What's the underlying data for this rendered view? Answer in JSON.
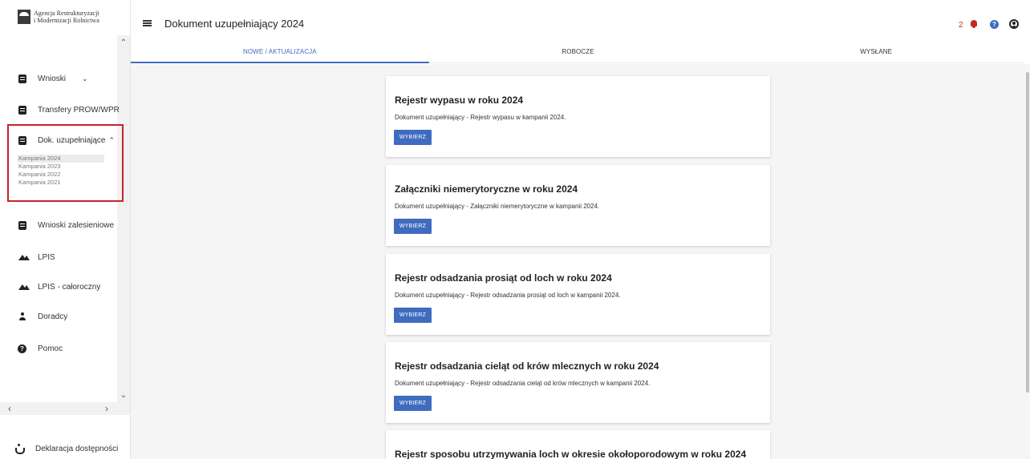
{
  "sidebar": {
    "logo": {
      "line1": "Agencja Restrukturyzacji",
      "line2": "i Modernizacji Rolnictwa"
    },
    "items": [
      {
        "label": "Wnioski",
        "icon": "document-icon"
      },
      {
        "label": "Transfery PROW/WPR",
        "icon": "document-icon"
      },
      {
        "label": "Dok. uzupełniające",
        "icon": "document-icon"
      },
      {
        "label": "Wnioski zalesieniowe",
        "icon": "document-icon"
      },
      {
        "label": "LPIS",
        "icon": "mountain-icon"
      },
      {
        "label": "LPIS - całoroczny",
        "icon": "mountain-icon"
      },
      {
        "label": "Doradcy",
        "icon": "person-icon"
      },
      {
        "label": "Pomoc",
        "icon": "help-icon"
      }
    ],
    "sub_items": [
      "Kampania 2024",
      "Kampania 2023",
      "Kampania 2022",
      "Kampania 2021"
    ],
    "active_sub_item": "Kampania 2024",
    "accessibility": "Deklaracja dostępności",
    "highlight_color": "#c5232a"
  },
  "header": {
    "title": "Dokument uzupełniający 2024",
    "notification_count": "2",
    "notification_color": "#c62828",
    "accent_color": "#3f6cbf"
  },
  "tabs": [
    {
      "label": "NOWE / AKTUALIZACJA",
      "active": true
    },
    {
      "label": "ROBOCZE",
      "active": false
    },
    {
      "label": "WYSŁANE",
      "active": false
    }
  ],
  "cards": [
    {
      "title": "Rejestr wypasu w roku 2024",
      "description": "Dokument uzupełniający - Rejestr wypasu w kampanii 2024.",
      "button": "WYBIERZ"
    },
    {
      "title": "Załączniki niemerytoryczne w roku 2024",
      "description": "Dokument uzupełniający - Załączniki niemerytoryczne w kampanii 2024.",
      "button": "WYBIERZ"
    },
    {
      "title": "Rejestr odsadzania prosiąt od loch w roku 2024",
      "description": "Dokument uzupełniający - Rejestr odsadzania prosiąt od loch w kampanii 2024.",
      "button": "WYBIERZ"
    },
    {
      "title": "Rejestr odsadzania cieląt od krów mlecznych w roku 2024",
      "description": "Dokument uzupełniający - Rejestr odsadzania cieląt od krów mlecznych w kampanii 2024.",
      "button": "WYBIERZ"
    },
    {
      "title": "Rejestr sposobu utrzymywania loch w okresie okołoporodowym w roku 2024",
      "description": "",
      "button": ""
    }
  ]
}
